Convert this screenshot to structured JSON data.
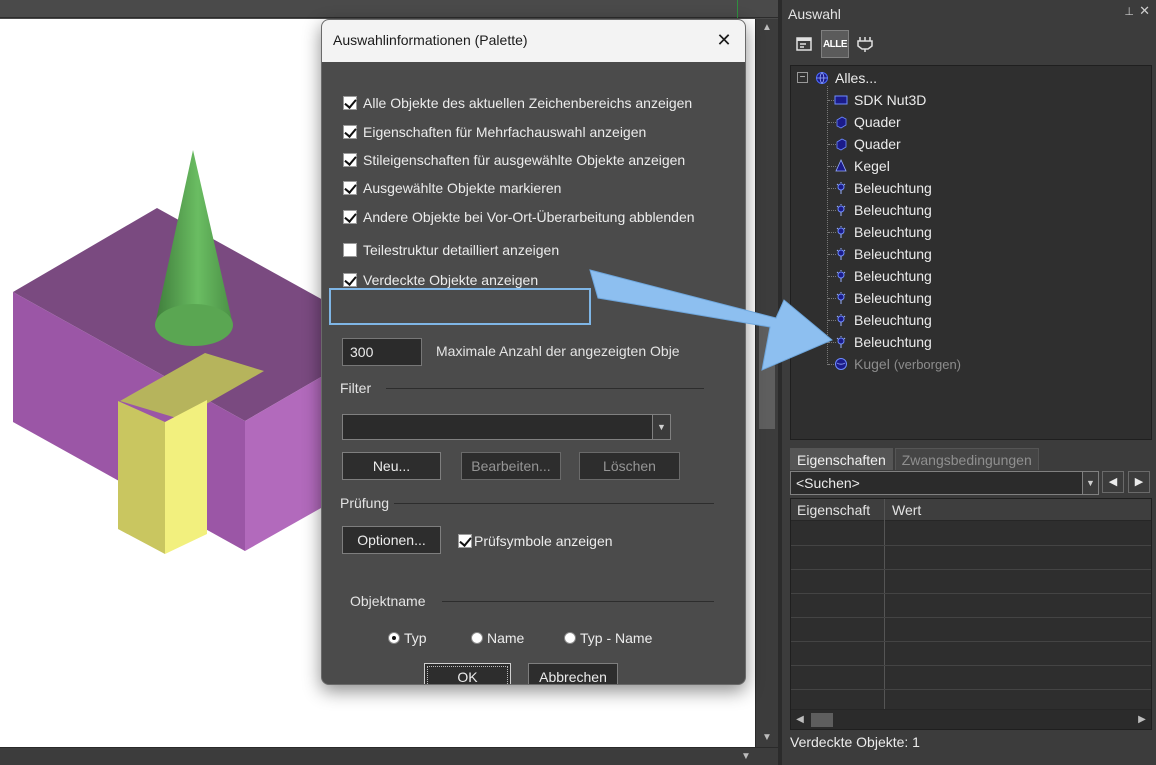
{
  "dialog": {
    "title": "Auswahlinformationen (Palette)",
    "close_glyph": "✕",
    "options": [
      {
        "label": "Alle Objekte des aktuellen Zeichenbereichs anzeigen",
        "checked": true
      },
      {
        "label": "Eigenschaften für Mehrfachauswahl anzeigen",
        "checked": true
      },
      {
        "label": "Stileigenschaften für ausgewählte Objekte anzeigen",
        "checked": true
      },
      {
        "label": "Ausgewählte Objekte markieren",
        "checked": true
      },
      {
        "label": "Andere Objekte bei Vor-Ort-Überarbeitung abblenden",
        "checked": true
      },
      {
        "label": "Teilestruktur detailliert anzeigen",
        "checked": false
      },
      {
        "label": "Verdeckte Objekte anzeigen",
        "checked": true
      }
    ],
    "max_count_value": "300",
    "max_count_label": "Maximale Anzahl der angezeigten Obje",
    "filter_label": "Filter",
    "filter_value": "",
    "btn_new": "Neu...",
    "btn_edit": "Bearbeiten...",
    "btn_delete": "Löschen",
    "check_label": "Prüfung",
    "btn_options": "Optionen...",
    "check_symbols_label": "Prüfsymbole anzeigen",
    "check_symbols_checked": true,
    "objname_label": "Objektname",
    "radio_typ": "Typ",
    "radio_name": "Name",
    "radio_typ_name": "Typ - Name",
    "radio_selected": "Typ",
    "btn_ok": "OK",
    "btn_cancel": "Abbrechen"
  },
  "palette": {
    "title": "Auswahl",
    "pin_glyph": "⊥",
    "close_glyph": "✕",
    "toolbar_alle": "ALLE",
    "tree_root": "Alles...",
    "tree_items": [
      {
        "label": "SDK Nut3D",
        "icon": "rectangle-icon",
        "hidden": false,
        "suffix": ""
      },
      {
        "label": "Quader",
        "icon": "cuboid-icon",
        "hidden": false,
        "suffix": ""
      },
      {
        "label": "Quader",
        "icon": "cuboid-icon",
        "hidden": false,
        "suffix": ""
      },
      {
        "label": "Kegel",
        "icon": "cone-icon",
        "hidden": false,
        "suffix": ""
      },
      {
        "label": "Beleuchtung",
        "icon": "light-icon",
        "hidden": false,
        "suffix": ""
      },
      {
        "label": "Beleuchtung",
        "icon": "light-icon",
        "hidden": false,
        "suffix": ""
      },
      {
        "label": "Beleuchtung",
        "icon": "light-icon",
        "hidden": false,
        "suffix": ""
      },
      {
        "label": "Beleuchtung",
        "icon": "light-icon",
        "hidden": false,
        "suffix": ""
      },
      {
        "label": "Beleuchtung",
        "icon": "light-icon",
        "hidden": false,
        "suffix": ""
      },
      {
        "label": "Beleuchtung",
        "icon": "light-icon",
        "hidden": false,
        "suffix": ""
      },
      {
        "label": "Beleuchtung",
        "icon": "light-icon",
        "hidden": false,
        "suffix": ""
      },
      {
        "label": "Beleuchtung",
        "icon": "light-icon",
        "hidden": false,
        "suffix": ""
      },
      {
        "label": "Kugel",
        "icon": "sphere-icon",
        "hidden": true,
        "suffix": "(verborgen)"
      }
    ],
    "tab_properties": "Eigenschaften",
    "tab_constraints": "Zwangsbedingungen",
    "search_value": "<Suchen>",
    "col_property": "Eigenschaft",
    "col_value": "Wert",
    "status_text": "Verdeckte Objekte: 1"
  },
  "colors": {
    "highlight": "#7fb6e6",
    "arrow": "#8dbff0",
    "box_purple": "#9b56a6",
    "cone_green": "#5fae5a",
    "block_yellow": "#ecec7a"
  }
}
